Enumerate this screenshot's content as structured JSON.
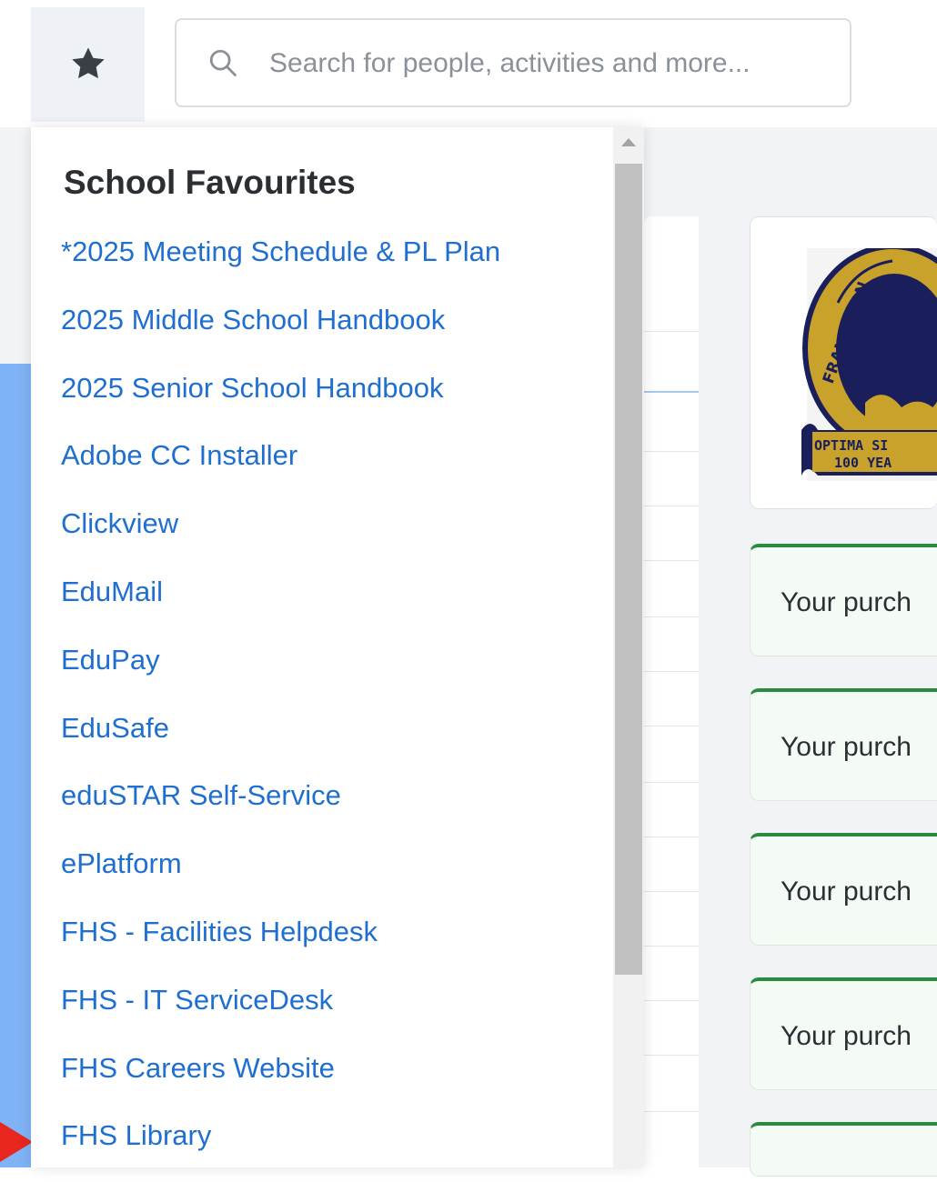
{
  "search": {
    "placeholder": "Search for people, activities and more..."
  },
  "favourites_menu": {
    "title": "School Favourites",
    "items": [
      "*2025 Meeting Schedule & PL Plan",
      "2025 Middle School Handbook",
      "2025 Senior School Handbook",
      "Adobe CC Installer",
      "Clickview",
      "EduMail",
      "EduPay",
      "EduSafe",
      "eduSTAR Self-Service",
      "ePlatform",
      "FHS - Facilities Helpdesk",
      "FHS - IT ServiceDesk",
      "FHS Careers Website",
      "FHS Library"
    ]
  },
  "logo": {
    "text_top": "FRANKSTON",
    "text_banner": "OPTIMA SI",
    "text_banner_2": "100 YEA"
  },
  "notices": [
    {
      "text": "Your purch"
    },
    {
      "text": "Your purch"
    },
    {
      "text": "Your purch"
    },
    {
      "text": "Your purch"
    }
  ],
  "colors": {
    "link": "#1f6fd1",
    "notice_accent": "#2c8a3f",
    "side_strip": "#7fb3f5",
    "arrow": "#e8261e"
  },
  "icons": {
    "favourites": "star-icon",
    "search": "search-icon"
  }
}
